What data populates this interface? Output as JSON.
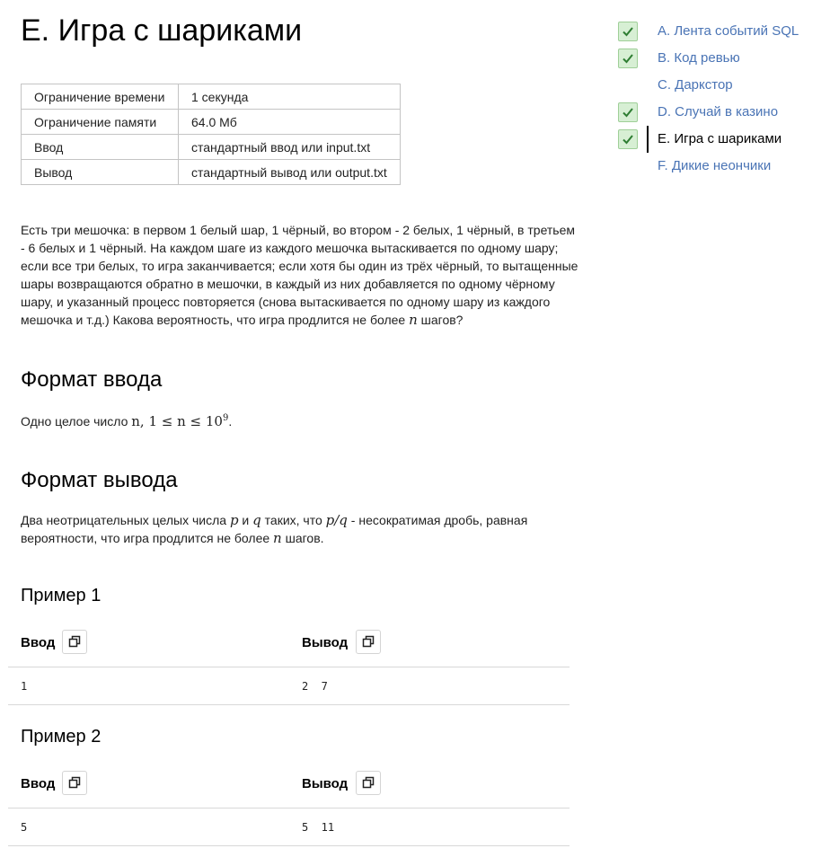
{
  "problem": {
    "title": "E. Игра с шариками",
    "limits": [
      {
        "label": "Ограничение времени",
        "value": "1 секунда"
      },
      {
        "label": "Ограничение памяти",
        "value": "64.0 Мб"
      },
      {
        "label": "Ввод",
        "value": "стандартный ввод или input.txt"
      },
      {
        "label": "Вывод",
        "value": "стандартный вывод или output.txt"
      }
    ],
    "statement": {
      "text": "Есть три мешочка: в первом 1 белый шар, 1 чёрный, во втором - 2 белых, 1 чёрный, в третьем - 6 белых и 1 чёрный. На каждом шаге из каждого мешочка вытаскивается по одному шару; если все три белых, то игра заканчивается; если хотя бы один из трёх чёрный, то вытащенные шары возвращаются обратно в мешочки, в каждый из них добавляется по одному чёрному шару, и указанный процесс повторяется (снова вытаскивается по одному шару из каждого мешочка и т.д.) Какова вероятность, что игра продлится не более",
      "var_n": "n",
      "tail": " шагов?"
    },
    "input_format": {
      "heading": "Формат ввода",
      "text": "Одно целое число ",
      "math": "n, 1 ≤ n ≤ 10",
      "exp": "9",
      "end": "."
    },
    "output_format": {
      "heading": "Формат вывода",
      "text1": "Два неотрицательных целых числа ",
      "var_p": "p",
      "text2": " и ",
      "var_q": "q",
      "text3": " таких, что ",
      "frac": "p/q",
      "text4": " - несократимая дробь, равная вероятности, что игра продлится не более ",
      "var_n": "n",
      "text5": " шагов."
    },
    "samples": [
      {
        "heading": "Пример 1",
        "input_label": "Ввод",
        "output_label": "Вывод",
        "input": "1",
        "output": "2  7"
      },
      {
        "heading": "Пример 2",
        "input_label": "Ввод",
        "output_label": "Вывод",
        "input": "5",
        "output": "5  11"
      }
    ]
  },
  "nav": {
    "items": [
      {
        "label": "A. Лента событий SQL",
        "solved": true,
        "active": false
      },
      {
        "label": "B. Код ревью",
        "solved": true,
        "active": false
      },
      {
        "label": "C. Даркстор",
        "solved": false,
        "active": false
      },
      {
        "label": "D. Случай в казино",
        "solved": true,
        "active": false
      },
      {
        "label": "E. Игра с шариками",
        "solved": true,
        "active": true
      },
      {
        "label": "F. Дикие неончики",
        "solved": false,
        "active": false
      }
    ]
  },
  "icons": {
    "copy": "copy-icon",
    "check": "checkmark-icon"
  },
  "colors": {
    "link": "#4a74b5",
    "check_bg": "#d7efd4",
    "check_mark": "#2e7d32"
  }
}
